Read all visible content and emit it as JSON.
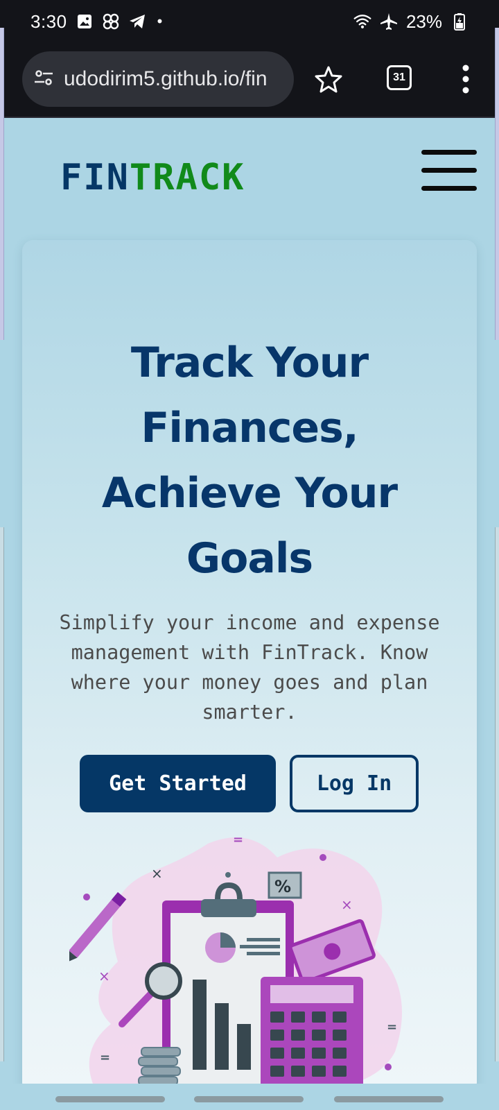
{
  "status_bar": {
    "time": "3:30",
    "dot": "•",
    "battery_pct": "23%",
    "icons": [
      "image-icon",
      "pinwheel-icon",
      "telegram-icon",
      "wifi-icon",
      "airplane-icon",
      "battery-icon"
    ]
  },
  "browser": {
    "url": "udodirim5.github.io/fin",
    "tab_count": "31",
    "icons": [
      "site-settings-icon",
      "star-icon",
      "tabs-icon",
      "more-menu-icon"
    ]
  },
  "site": {
    "logo_fin": "FIN",
    "logo_track": "TRACK",
    "menu_icon": "hamburger-icon",
    "hero": {
      "title": "Track Your Finances, Achieve Your Goals",
      "subtitle": "Simplify your income and expense management with FinTrack. Know where your money goes and plan smarter.",
      "primary_button": "Get Started",
      "secondary_button": "Log In",
      "illustration": "finance-clipboard-illustration"
    }
  },
  "colors": {
    "brand_dark_blue": "#053766",
    "brand_green": "#118a1a",
    "page_background": "#acd5e4",
    "accent_purple": "#a54bbd"
  }
}
